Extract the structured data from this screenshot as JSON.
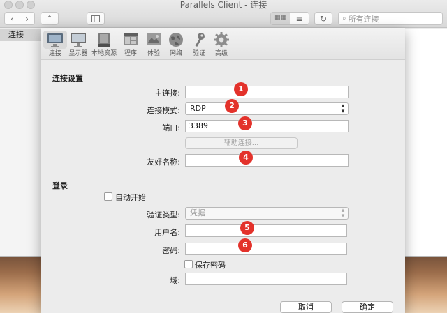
{
  "window": {
    "title": "Parallels Client - 连接",
    "search_placeholder": "所有连接"
  },
  "sidebar": {
    "items": [
      {
        "label": "连接"
      }
    ]
  },
  "dialog": {
    "toolbar": [
      {
        "label": "连接",
        "icon": "monitor-icon"
      },
      {
        "label": "显示器",
        "icon": "display-icon"
      },
      {
        "label": "本地资源",
        "icon": "disk-icon"
      },
      {
        "label": "程序",
        "icon": "program-icon"
      },
      {
        "label": "体验",
        "icon": "experience-icon"
      },
      {
        "label": "网络",
        "icon": "globe-icon"
      },
      {
        "label": "验证",
        "icon": "key-icon"
      },
      {
        "label": "高级",
        "icon": "gear-icon"
      }
    ],
    "connection_section": {
      "title": "连接设置",
      "primary_label": "主连接:",
      "primary_value": "",
      "mode_label": "连接模式:",
      "mode_value": "RDP",
      "port_label": "端口:",
      "port_value": "3389",
      "secondary_button": "辅助连接...",
      "friendly_label": "友好名称:",
      "friendly_value": ""
    },
    "login_section": {
      "title": "登录",
      "auto_start_label": "自动开始",
      "auth_type_label": "验证类型:",
      "auth_type_value": "凭据",
      "username_label": "用户名:",
      "username_value": "",
      "password_label": "密码:",
      "password_value": "",
      "save_password_label": "保存密码",
      "domain_label": "域:",
      "domain_value": ""
    },
    "cancel_label": "取消",
    "ok_label": "确定"
  },
  "badges": [
    "1",
    "2",
    "3",
    "4",
    "5",
    "6"
  ],
  "colors": {
    "badge": "#e3322b"
  }
}
